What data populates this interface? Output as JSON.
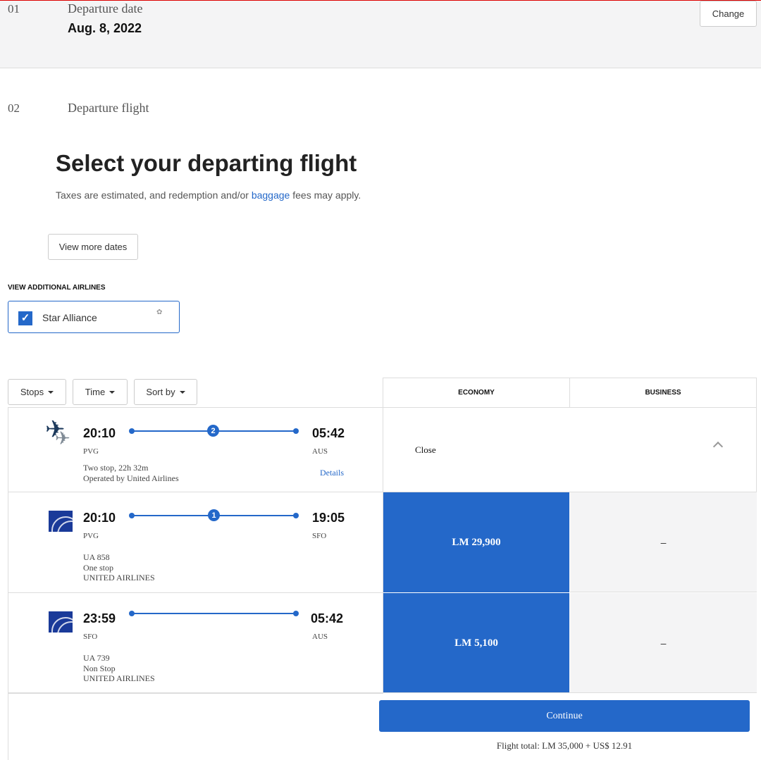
{
  "step1": {
    "number": "01",
    "label": "Departure date",
    "value": "Aug. 8, 2022",
    "change_label": "Change"
  },
  "step2": {
    "number": "02",
    "label": "Departure flight"
  },
  "heading": "Select your departing flight",
  "subtext": {
    "before": "Taxes are estimated, and redemption and/or ",
    "link": "baggage",
    "after": " fees may apply."
  },
  "view_more_dates": "View more dates",
  "additional_airlines": {
    "title": "VIEW ADDITIONAL AIRLINES",
    "option": "Star Alliance",
    "checked": true
  },
  "filters": [
    "Stops",
    "Time",
    "Sort by"
  ],
  "cabins": [
    "ECONOMY",
    "BUSINESS"
  ],
  "accent": "#2468c9",
  "selected": {
    "depart": "20:10",
    "from": "PVG",
    "arrive": "05:42",
    "to": "AUS",
    "stops": "2",
    "summary": "Two stop, 22h 32m",
    "operator": "Operated by United Airlines",
    "details": "Details",
    "close": "Close"
  },
  "segments": [
    {
      "depart": "20:10",
      "from": "PVG",
      "arrive": "19:05",
      "to": "SFO",
      "stops": "1",
      "flight": "UA 858",
      "stop_text": "One stop",
      "airline": "UNITED AIRLINES",
      "economy": "LM 29,900",
      "business": "–"
    },
    {
      "depart": "23:59",
      "from": "SFO",
      "arrive": "05:42",
      "to": "AUS",
      "stops": "",
      "flight": "UA 739",
      "stop_text": "Non Stop",
      "airline": "UNITED AIRLINES",
      "economy": "LM 5,100",
      "business": "–"
    }
  ],
  "continue_label": "Continue",
  "flight_total": "Flight total: LM 35,000 + US$ 12.91"
}
